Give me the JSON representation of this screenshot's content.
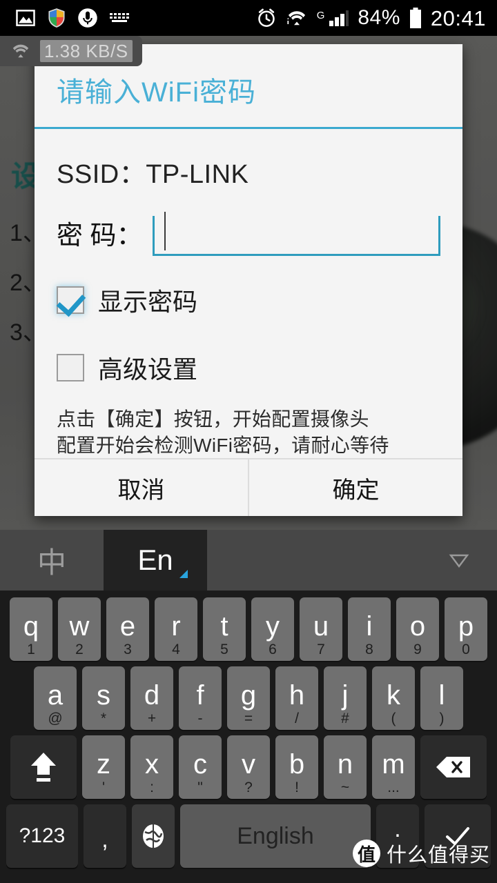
{
  "statusbar": {
    "icons_left": [
      "gallery-icon",
      "shield-icon",
      "microphone-icon",
      "keyboard-icon"
    ],
    "icons_right": [
      "alarm-icon",
      "wifi-icon",
      "signal-icon"
    ],
    "network_type": "G",
    "battery_percent": "84%",
    "time": "20:41"
  },
  "speed_badge": {
    "icon": "wifi-icon",
    "value": "1.38 KB/S"
  },
  "background": {
    "heading": "设",
    "items": [
      "1、",
      "2、",
      "3、"
    ]
  },
  "dialog": {
    "title": "请输入WiFi密码",
    "ssid_label": "SSID：",
    "ssid_value": "TP-LINK",
    "password_label": "密 码：",
    "password_value": "",
    "password_placeholder": "",
    "checkbox_show_password": {
      "label": "显示密码",
      "checked": true
    },
    "checkbox_advanced": {
      "label": "高级设置",
      "checked": false
    },
    "hint_line1": "点击【确定】按钮，开始配置摄像头",
    "hint_line2": "配置开始会检测WiFi密码，请耐心等待",
    "cancel_label": "取消",
    "ok_label": "确定",
    "accent_color": "#3aa9cf",
    "title_color": "#49b0d6"
  },
  "keyboard": {
    "toolbar": {
      "lang_cn": "中",
      "lang_en": "En",
      "collapse_icon": "chevron-down-icon"
    },
    "row1": [
      {
        "main": "q",
        "sub": "1"
      },
      {
        "main": "w",
        "sub": "2"
      },
      {
        "main": "e",
        "sub": "3"
      },
      {
        "main": "r",
        "sub": "4"
      },
      {
        "main": "t",
        "sub": "5"
      },
      {
        "main": "y",
        "sub": "6"
      },
      {
        "main": "u",
        "sub": "7"
      },
      {
        "main": "i",
        "sub": "8"
      },
      {
        "main": "o",
        "sub": "9"
      },
      {
        "main": "p",
        "sub": "0"
      }
    ],
    "row2": [
      {
        "main": "a",
        "sub": "@"
      },
      {
        "main": "s",
        "sub": "*"
      },
      {
        "main": "d",
        "sub": "+"
      },
      {
        "main": "f",
        "sub": "-"
      },
      {
        "main": "g",
        "sub": "="
      },
      {
        "main": "h",
        "sub": "/"
      },
      {
        "main": "j",
        "sub": "#"
      },
      {
        "main": "k",
        "sub": "("
      },
      {
        "main": "l",
        "sub": ")"
      }
    ],
    "row3": [
      {
        "main": "z",
        "sub": "'"
      },
      {
        "main": "x",
        "sub": ":"
      },
      {
        "main": "c",
        "sub": "\""
      },
      {
        "main": "v",
        "sub": "?"
      },
      {
        "main": "b",
        "sub": "!"
      },
      {
        "main": "n",
        "sub": "~"
      },
      {
        "main": "m",
        "sub": "..."
      }
    ],
    "shift_icon": "shift-icon",
    "backspace_icon": "backspace-icon",
    "row4": {
      "symbols_label": "?123",
      "comma_label": ",",
      "globe_icon": "globe-icon",
      "space_label": "English",
      "period_label": ".",
      "enter_icon": "check-icon"
    }
  },
  "watermark": {
    "logo": "值",
    "text": "什么值得买"
  }
}
